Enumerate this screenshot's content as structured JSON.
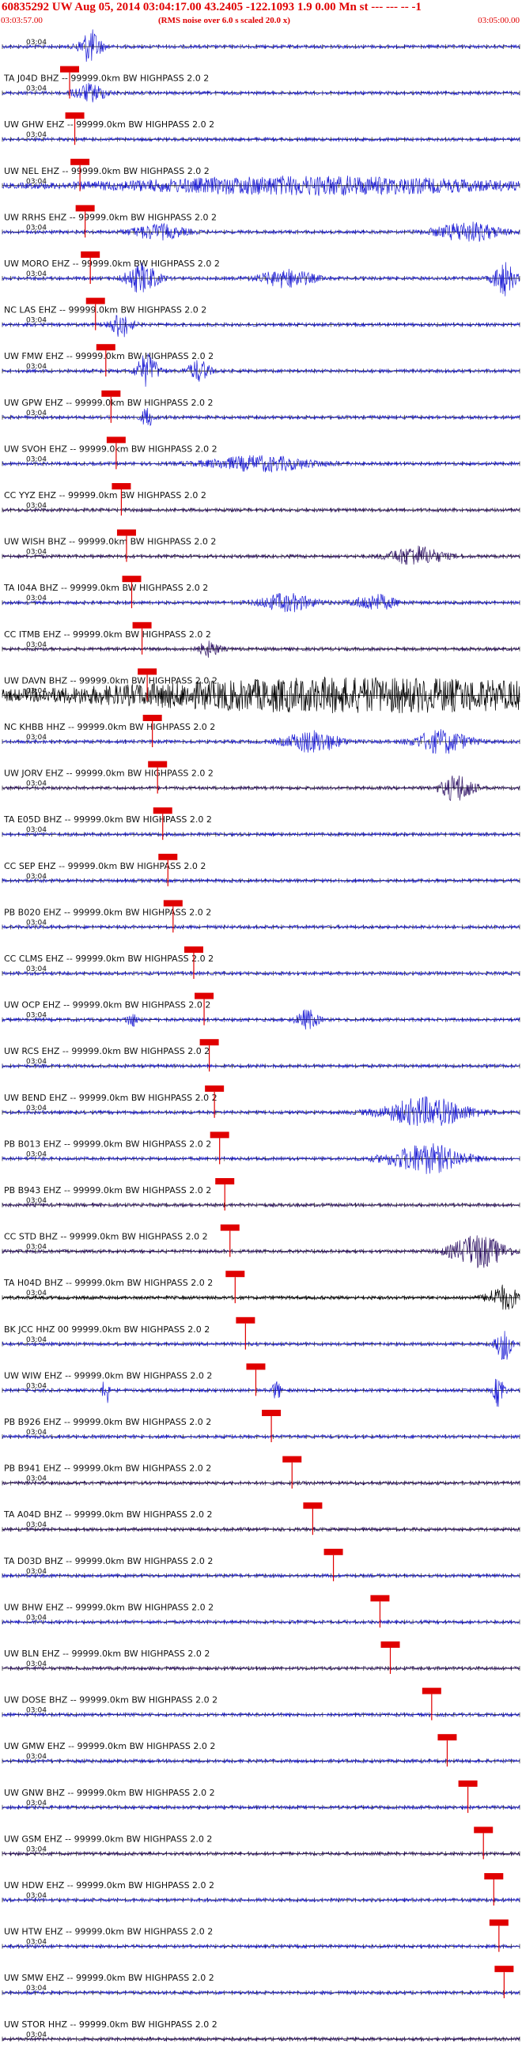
{
  "header": {
    "title": "60835292 UW Aug 05, 2014 03:04:17.00   43.2405 -122.1093  1.9 0.00 Mn st --- --- --  -1",
    "start_time": "03:03:57.00",
    "note": "(RMS noise over 6.0 s scaled 20.0 x)",
    "end_time": "03:05:00.00"
  },
  "colors": {
    "header_red": "#e00000",
    "trace_blue": "#1f1fd6",
    "trace_purple": "#301466",
    "trace_black": "#000000",
    "pick_red": "#e00000"
  },
  "chart_data": {
    "type": "seismogram",
    "x_start": "03:03:57.00",
    "x_end": "03:05:00.00",
    "traces": [
      {
        "label": "",
        "time": "03:04",
        "pick": "",
        "color": "blue",
        "env": [
          {
            "t": 0.17,
            "a": 3.5,
            "w": 0.02
          }
        ]
      },
      {
        "label": "TA J04D BHZ -- 99999.0km BW  HIGHPASS  2.0  2",
        "time": "03:04",
        "pick": "",
        "color": "blue",
        "env": [
          {
            "t": 0.17,
            "a": 1.8,
            "w": 0.03
          }
        ]
      },
      {
        "label": "UW GHW EHZ -- 99999.0km BW  HIGHPASS  2.0  2",
        "time": "03:04",
        "pick": "",
        "color": "blue",
        "env": []
      },
      {
        "label": "UW NEL EHZ -- 99999.0km BW  HIGHPASS  2.0  2",
        "time": "03:04",
        "pick": "",
        "color": "blue",
        "env": [
          {
            "t": 0.6,
            "a": 1.8,
            "w": 0.4
          }
        ]
      },
      {
        "label": "UW RRHS EHZ -- 99999.0km BW  HIGHPASS  2.0  2",
        "time": "03:04",
        "pick": "",
        "color": "blue",
        "env": [
          {
            "t": 0.3,
            "a": 1.5,
            "w": 0.05
          },
          {
            "t": 0.9,
            "a": 2.0,
            "w": 0.06
          }
        ]
      },
      {
        "label": "UW MORO EHZ -- 99999.0km BW  HIGHPASS  2.0  2",
        "time": "03:04",
        "pick": "",
        "color": "blue",
        "env": [
          {
            "t": 0.27,
            "a": 3.0,
            "w": 0.03
          },
          {
            "t": 0.55,
            "a": 1.8,
            "w": 0.05
          },
          {
            "t": 0.97,
            "a": 3.5,
            "w": 0.02
          }
        ]
      },
      {
        "label": "NC LAS EHZ -- 99999.0km BW  HIGHPASS  2.0  2",
        "time": "03:04",
        "pick": "",
        "color": "blue",
        "env": [
          {
            "t": 0.23,
            "a": 2.5,
            "w": 0.02
          }
        ]
      },
      {
        "label": "UW FMW EHZ -- 99999.0km BW  HIGHPASS  2.0  2",
        "time": "03:04",
        "pick": "",
        "color": "blue",
        "env": [
          {
            "t": 0.28,
            "a": 3.5,
            "w": 0.02
          },
          {
            "t": 0.38,
            "a": 2.2,
            "w": 0.02
          }
        ]
      },
      {
        "label": "UW GPW EHZ -- 99999.0km BW  HIGHPASS  2.0  2",
        "time": "03:04",
        "pick": "",
        "color": "blue",
        "env": [
          {
            "t": 0.28,
            "a": 2.2,
            "w": 0.01
          }
        ]
      },
      {
        "label": "UW SVOH EHZ -- 99999.0km BW  HIGHPASS  2.0  2",
        "time": "03:04",
        "pick": "",
        "color": "blue",
        "env": [
          {
            "t": 0.5,
            "a": 1.5,
            "w": 0.1
          }
        ]
      },
      {
        "label": "CC YYZ EHZ -- 99999.0km BW  HIGHPASS  2.0  2",
        "time": "03:04",
        "pick": "",
        "color": "purple",
        "env": []
      },
      {
        "label": "UW WISH BHZ -- 99999.0km BW  HIGHPASS  2.0  2",
        "time": "03:04",
        "pick": "",
        "color": "purple",
        "env": [
          {
            "t": 0.8,
            "a": 2.0,
            "w": 0.05
          }
        ]
      },
      {
        "label": "TA I04A BHZ -- 99999.0km BW  HIGHPASS  2.0  2",
        "time": "03:04",
        "pick": "",
        "color": "blue",
        "env": [
          {
            "t": 0.55,
            "a": 1.8,
            "w": 0.05
          },
          {
            "t": 0.72,
            "a": 1.6,
            "w": 0.04
          }
        ]
      },
      {
        "label": "CC ITMB EHZ -- 99999.0km BW  HIGHPASS  2.0  2",
        "time": "03:04",
        "pick": "",
        "color": "purple",
        "env": [
          {
            "t": 0.4,
            "a": 1.5,
            "w": 0.02
          }
        ]
      },
      {
        "label": "UW DAVN BHZ -- 99999.0km BW  HIGHPASS  2.0  2",
        "time": "03:04",
        "pick": "",
        "color": "black",
        "env": [
          {
            "t": 0.7,
            "a": 3.5,
            "w": 0.6
          }
        ]
      },
      {
        "label": "NC KHBB HHZ -- 99999.0km BW  HIGHPASS  2.0  2",
        "time": "03:04",
        "pick": "",
        "color": "blue",
        "env": [
          {
            "t": 0.6,
            "a": 2.2,
            "w": 0.05
          },
          {
            "t": 0.85,
            "a": 2.4,
            "w": 0.05
          }
        ]
      },
      {
        "label": "UW JORV EHZ -- 99999.0km BW  HIGHPASS  2.0  2",
        "time": "03:04",
        "pick": "",
        "color": "purple",
        "env": [
          {
            "t": 0.88,
            "a": 2.8,
            "w": 0.03
          }
        ]
      },
      {
        "label": "TA E05D BHZ -- 99999.0km BW  HIGHPASS  2.0  2",
        "time": "03:04",
        "pick": "",
        "color": "blue",
        "env": []
      },
      {
        "label": "CC SEP EHZ -- 99999.0km BW  HIGHPASS  2.0  2",
        "time": "03:04",
        "pick": "",
        "color": "blue",
        "env": []
      },
      {
        "label": "PB B020 EHZ -- 99999.0km BW  HIGHPASS  2.0  2",
        "time": "03:04",
        "pick": "",
        "color": "blue",
        "env": []
      },
      {
        "label": "CC CLMS EHZ -- 99999.0km BW  HIGHPASS  2.0  2",
        "time": "03:04",
        "pick": "",
        "color": "blue",
        "env": []
      },
      {
        "label": "UW OCP EHZ -- 99999.0km BW  HIGHPASS  2.0  2",
        "time": "03:04",
        "pick": "",
        "color": "blue",
        "env": [
          {
            "t": 0.25,
            "a": 1.5,
            "w": 0.01
          },
          {
            "t": 0.59,
            "a": 2.0,
            "w": 0.02
          }
        ]
      },
      {
        "label": "UW RCS EHZ -- 99999.0km BW  HIGHPASS  2.0  2",
        "time": "03:04",
        "pick": "",
        "color": "blue",
        "env": []
      },
      {
        "label": "UW BEND EHZ -- 99999.0km BW  HIGHPASS  2.0  2",
        "time": "03:04",
        "pick": "",
        "color": "blue",
        "env": [
          {
            "t": 0.82,
            "a": 3.0,
            "w": 0.08
          }
        ]
      },
      {
        "label": "PB B013 EHZ -- 99999.0km BW  HIGHPASS  2.0  2",
        "time": "03:04",
        "pick": "",
        "color": "blue",
        "env": [
          {
            "t": 0.82,
            "a": 3.0,
            "w": 0.07
          }
        ]
      },
      {
        "label": "PB B943 EHZ -- 99999.0km BW  HIGHPASS  2.0  2",
        "time": "03:04",
        "pick": "",
        "color": "purple",
        "env": []
      },
      {
        "label": "CC STD BHZ -- 99999.0km BW  HIGHPASS  2.0  2",
        "time": "03:04",
        "pick": "",
        "color": "purple",
        "env": [
          {
            "t": 0.92,
            "a": 3.5,
            "w": 0.05
          }
        ]
      },
      {
        "label": "TA H04D BHZ -- 99999.0km BW  HIGHPASS  2.0  2",
        "time": "03:04",
        "pick": "",
        "color": "black",
        "env": [
          {
            "t": 0.97,
            "a": 2.5,
            "w": 0.03
          }
        ]
      },
      {
        "label": "BK JCC HHZ 00 99999.0km BW  HIGHPASS  2.0  2",
        "time": "03:04",
        "pick": "",
        "color": "blue",
        "env": [
          {
            "t": 0.97,
            "a": 3.5,
            "w": 0.015
          }
        ]
      },
      {
        "label": "UW WIW EHZ -- 99999.0km BW  HIGHPASS  2.0  2",
        "time": "03:04",
        "pick": "",
        "color": "blue",
        "env": [
          {
            "t": 0.2,
            "a": 3.5,
            "w": 0.006
          },
          {
            "t": 0.53,
            "a": 2.0,
            "w": 0.008
          },
          {
            "t": 0.96,
            "a": 3.5,
            "w": 0.01
          }
        ]
      },
      {
        "label": "PB B926 EHZ -- 99999.0km BW  HIGHPASS  2.0  2",
        "time": "03:04",
        "pick": "",
        "color": "blue",
        "env": []
      },
      {
        "label": "PB B941 EHZ -- 99999.0km BW  HIGHPASS  2.0  2",
        "time": "03:04",
        "pick": "",
        "color": "purple",
        "env": []
      },
      {
        "label": "TA A04D BHZ -- 99999.0km BW  HIGHPASS  2.0  2",
        "time": "03:04",
        "pick": "",
        "color": "purple",
        "env": []
      },
      {
        "label": "TA D03D BHZ -- 99999.0km BW  HIGHPASS  2.0  2",
        "time": "03:04",
        "pick": "",
        "color": "blue",
        "env": []
      },
      {
        "label": "UW BHW EHZ -- 99999.0km BW  HIGHPASS  2.0  2",
        "time": "03:04",
        "pick": "",
        "color": "blue",
        "env": []
      },
      {
        "label": "UW BLN EHZ -- 99999.0km BW  HIGHPASS  2.0  2",
        "time": "03:04",
        "pick": "",
        "color": "purple",
        "env": []
      },
      {
        "label": "UW DOSE BHZ -- 99999.0km BW  HIGHPASS  2.0  2",
        "time": "03:04",
        "pick": "",
        "color": "blue",
        "env": []
      },
      {
        "label": "UW GMW EHZ -- 99999.0km BW  HIGHPASS  2.0  2",
        "time": "03:04",
        "pick": "",
        "color": "blue",
        "env": []
      },
      {
        "label": "UW GNW BHZ -- 99999.0km BW  HIGHPASS  2.0  2",
        "time": "03:04",
        "pick": "",
        "color": "blue",
        "env": []
      },
      {
        "label": "UW GSM EHZ -- 99999.0km BW  HIGHPASS  2.0  2",
        "time": "03:04",
        "pick": "",
        "color": "purple",
        "env": []
      },
      {
        "label": "UW HDW EHZ -- 99999.0km BW  HIGHPASS  2.0  2",
        "time": "03:04",
        "pick": "",
        "color": "blue",
        "env": []
      },
      {
        "label": "UW HTW EHZ -- 99999.0km BW  HIGHPASS  2.0  2",
        "time": "03:04",
        "pick": "",
        "color": "blue",
        "env": []
      },
      {
        "label": "UW SMW EHZ -- 99999.0km BW  HIGHPASS  2.0  2",
        "time": "03:04",
        "pick": "",
        "color": "blue",
        "env": []
      },
      {
        "label": "UW STOR HHZ -- 99999.0km BW  HIGHPASS  2.0  2",
        "time": "03:04",
        "pick": "",
        "color": "purple",
        "env": []
      }
    ],
    "picks": [
      0.13,
      0.14,
      0.15,
      0.16,
      0.17,
      0.18,
      0.2,
      0.21,
      0.22,
      0.23,
      0.24,
      0.25,
      0.27,
      0.28,
      0.29,
      0.3,
      0.31,
      0.32,
      0.33,
      0.37,
      0.39,
      0.4,
      0.41,
      0.42,
      0.43,
      0.44,
      0.45,
      0.47,
      0.49,
      0.52,
      0.56,
      0.6,
      0.64,
      0.73,
      0.75,
      0.83,
      0.86,
      0.9,
      0.93,
      0.95,
      0.96,
      0.97
    ]
  }
}
